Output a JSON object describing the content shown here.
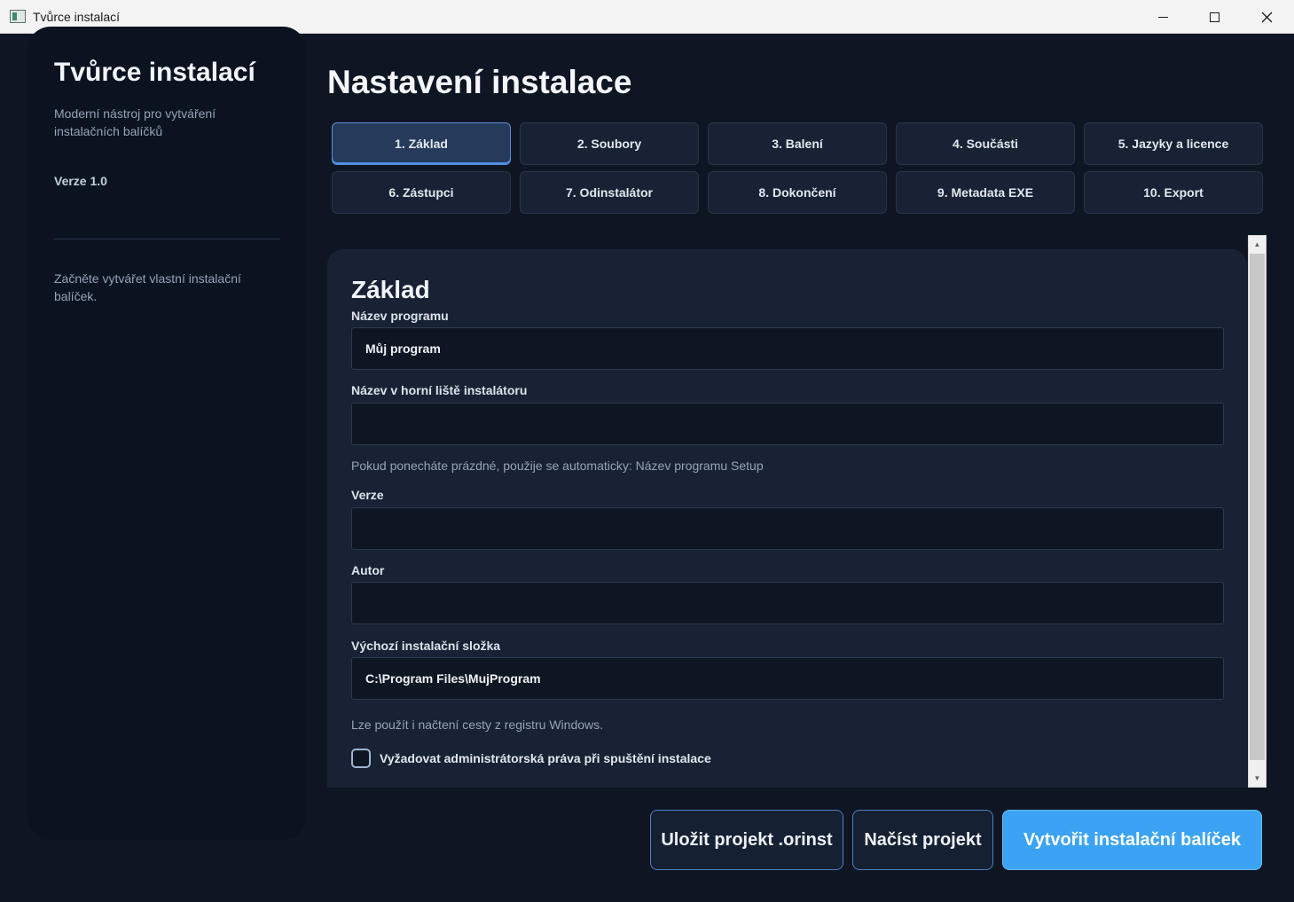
{
  "window": {
    "title": "Tvůrce instalací"
  },
  "sidebar": {
    "title": "Tvůrce instalací",
    "subtitle": "Moderní nástroj pro vytváření instalačních balíčků",
    "version": "Verze 1.0",
    "note": "Začněte vytvářet vlastní instalační balíček."
  },
  "page": {
    "title": "Nastavení instalace"
  },
  "tabs": [
    {
      "label": "1. Základ",
      "active": true
    },
    {
      "label": "2. Soubory",
      "active": false
    },
    {
      "label": "3. Balení",
      "active": false
    },
    {
      "label": "4. Součásti",
      "active": false
    },
    {
      "label": "5. Jazyky a licence",
      "active": false
    },
    {
      "label": "6. Zástupci",
      "active": false
    },
    {
      "label": "7. Odinstalátor",
      "active": false
    },
    {
      "label": "8. Dokončení",
      "active": false
    },
    {
      "label": "9. Metadata EXE",
      "active": false
    },
    {
      "label": "10. Export",
      "active": false
    }
  ],
  "form": {
    "section_title": "Základ",
    "program_name_label": "Název programu",
    "program_name_value": "Můj program",
    "window_title_label": "Název v horní liště instalátoru",
    "window_title_value": "",
    "window_title_hint": "Pokud ponecháte prázdné, použije se automaticky: Název programu Setup",
    "version_label": "Verze",
    "version_value": "",
    "author_label": "Autor",
    "author_value": "",
    "install_dir_label": "Výchozí instalační složka",
    "install_dir_value": "C:\\Program Files\\MujProgram",
    "install_dir_hint": "Lze použít i načtení cesty z registru Windows.",
    "admin_checkbox_label": "Vyžadovat administrátorská práva při spuštění instalace",
    "admin_checked": false
  },
  "actions": {
    "save_label": "Uložit projekt .orinst",
    "load_label": "Načíst projekt",
    "build_label": "Vytvořit instalační balíček"
  },
  "colors": {
    "background": "#0f1623",
    "sidebar": "#0b1220",
    "panel": "#182234",
    "accent": "#3ba3f3",
    "tab_active_border": "#5b8ed8"
  },
  "icons": {
    "minimize": "minimize-icon",
    "maximize": "maximize-icon",
    "close": "close-icon",
    "scroll_up": "triangle-up-icon",
    "scroll_down": "triangle-down-icon"
  }
}
